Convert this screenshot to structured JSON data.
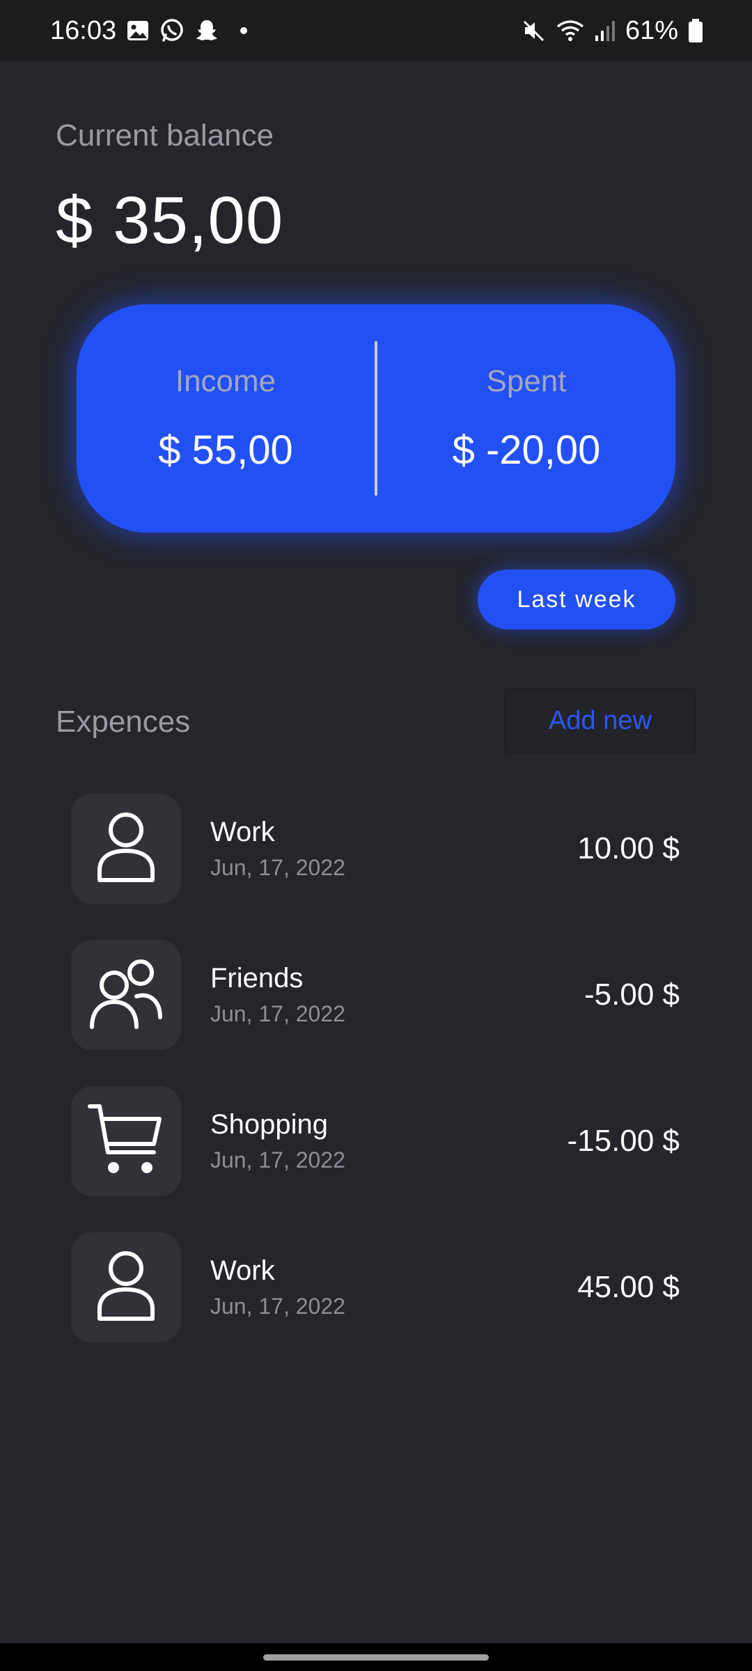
{
  "status_bar": {
    "time": "16:03",
    "battery": "61%",
    "icons_left": [
      "gallery-icon",
      "whatsapp-icon",
      "snapchat-icon",
      "notification-dot"
    ],
    "icons_right": [
      "mute-icon",
      "wifi-icon",
      "signal-icon",
      "battery-icon"
    ]
  },
  "balance": {
    "label": "Current balance",
    "value": "$ 35,00"
  },
  "summary": {
    "income_label": "Income",
    "income_value": "$ 55,00",
    "spent_label": "Spent",
    "spent_value": "$ -20,00",
    "accent_color": "#2350f5"
  },
  "period_button": "Last week",
  "expenses": {
    "title": "Expences",
    "add_label": "Add new",
    "items": [
      {
        "name": "Work",
        "date": "Jun, 17, 2022",
        "amount": "10.00 $",
        "icon": "person-icon"
      },
      {
        "name": "Friends",
        "date": "Jun, 17, 2022",
        "amount": "-5.00 $",
        "icon": "people-icon"
      },
      {
        "name": "Shopping",
        "date": "Jun, 17, 2022",
        "amount": "-15.00 $",
        "icon": "cart-icon"
      },
      {
        "name": "Work",
        "date": "Jun, 17, 2022",
        "amount": "45.00 $",
        "icon": "person-icon"
      }
    ]
  }
}
